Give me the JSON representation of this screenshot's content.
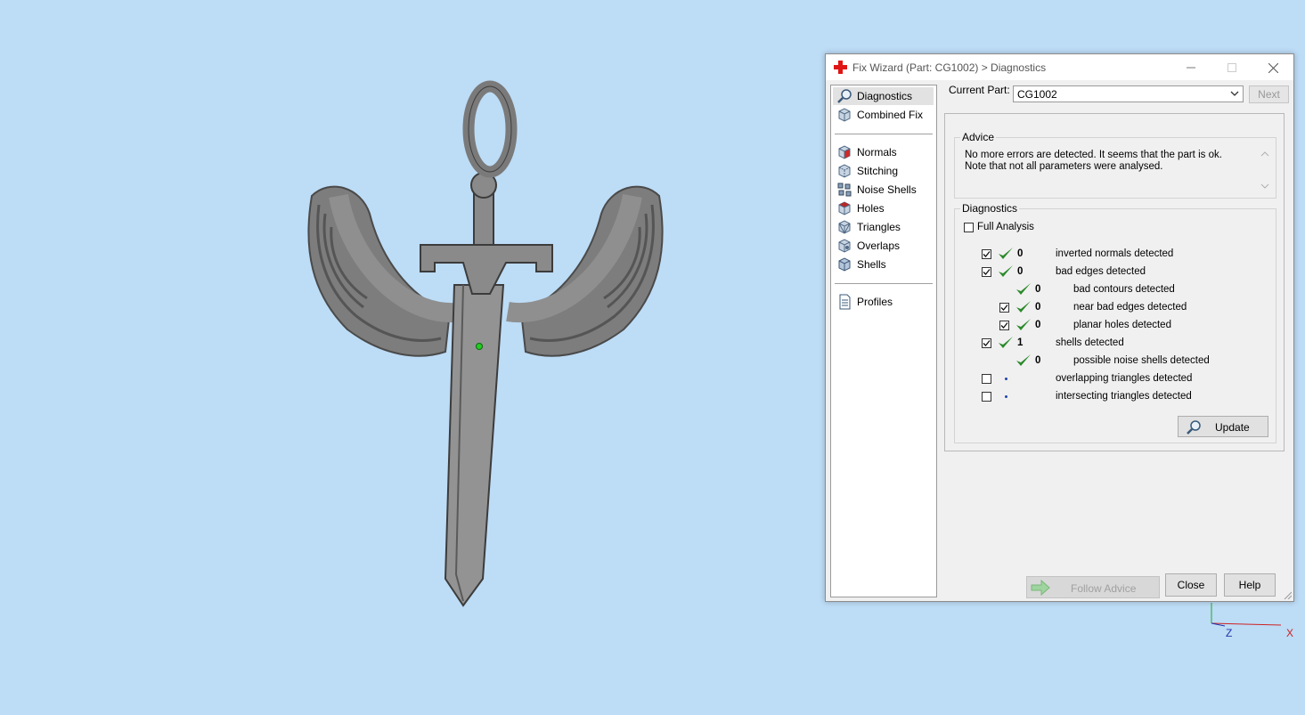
{
  "window": {
    "title": "Fix Wizard (Part: CG1002) > Diagnostics",
    "minimize_icon": "minimize-icon",
    "maximize_icon": "maximize-icon",
    "close_icon": "close-icon"
  },
  "nav": {
    "items": [
      {
        "label": "Diagnostics",
        "icon": "magnifier-icon",
        "selected": true
      },
      {
        "label": "Combined Fix",
        "icon": "cube-icon"
      },
      {
        "label": "Normals",
        "icon": "normals-cube-icon"
      },
      {
        "label": "Stitching",
        "icon": "stitching-cube-icon"
      },
      {
        "label": "Noise Shells",
        "icon": "noise-shells-icon"
      },
      {
        "label": "Holes",
        "icon": "holes-cube-icon"
      },
      {
        "label": "Triangles",
        "icon": "triangles-cube-icon"
      },
      {
        "label": "Overlaps",
        "icon": "overlaps-cube-icon"
      },
      {
        "label": "Shells",
        "icon": "shells-cube-icon"
      },
      {
        "label": "Profiles",
        "icon": "document-icon"
      }
    ]
  },
  "toolbar": {
    "current_part_label": "Current Part:",
    "current_part_value": "CG1002",
    "next_label": "Next"
  },
  "advice": {
    "title": "Advice",
    "text": "No more errors are detected. It seems that the part is ok. Note that not all parameters were analysed."
  },
  "diagnostics": {
    "title": "Diagnostics",
    "full_analysis_label": "Full Analysis",
    "full_analysis_checked": false,
    "rows": [
      {
        "checkbox": true,
        "checked": true,
        "status": "ok",
        "count": "0",
        "label": "inverted normals detected",
        "indent": 0
      },
      {
        "checkbox": true,
        "checked": true,
        "status": "ok",
        "count": "0",
        "label": "bad edges detected",
        "indent": 0
      },
      {
        "checkbox": false,
        "checked": false,
        "status": "ok",
        "count": "0",
        "label": "bad contours detected",
        "indent": 1
      },
      {
        "checkbox": true,
        "checked": true,
        "status": "ok",
        "count": "0",
        "label": "near bad edges detected",
        "indent": 1
      },
      {
        "checkbox": true,
        "checked": true,
        "status": "ok",
        "count": "0",
        "label": "planar holes detected",
        "indent": 1
      },
      {
        "checkbox": true,
        "checked": true,
        "status": "ok",
        "count": "1",
        "label": "shells detected",
        "indent": 0
      },
      {
        "checkbox": false,
        "checked": false,
        "status": "ok",
        "count": "0",
        "label": "possible noise shells detected",
        "indent": 1
      },
      {
        "checkbox": true,
        "checked": false,
        "status": "pending",
        "count": "",
        "label": "overlapping triangles detected",
        "indent": 0
      },
      {
        "checkbox": true,
        "checked": false,
        "status": "pending",
        "count": "",
        "label": "intersecting triangles detected",
        "indent": 0
      }
    ],
    "update_label": "Update"
  },
  "footer": {
    "follow_advice_label": "Follow Advice",
    "close_label": "Close",
    "help_label": "Help"
  },
  "viewport": {
    "axis_z_label": "Z",
    "axis_x_label": "X",
    "background": "#bddcf6"
  }
}
